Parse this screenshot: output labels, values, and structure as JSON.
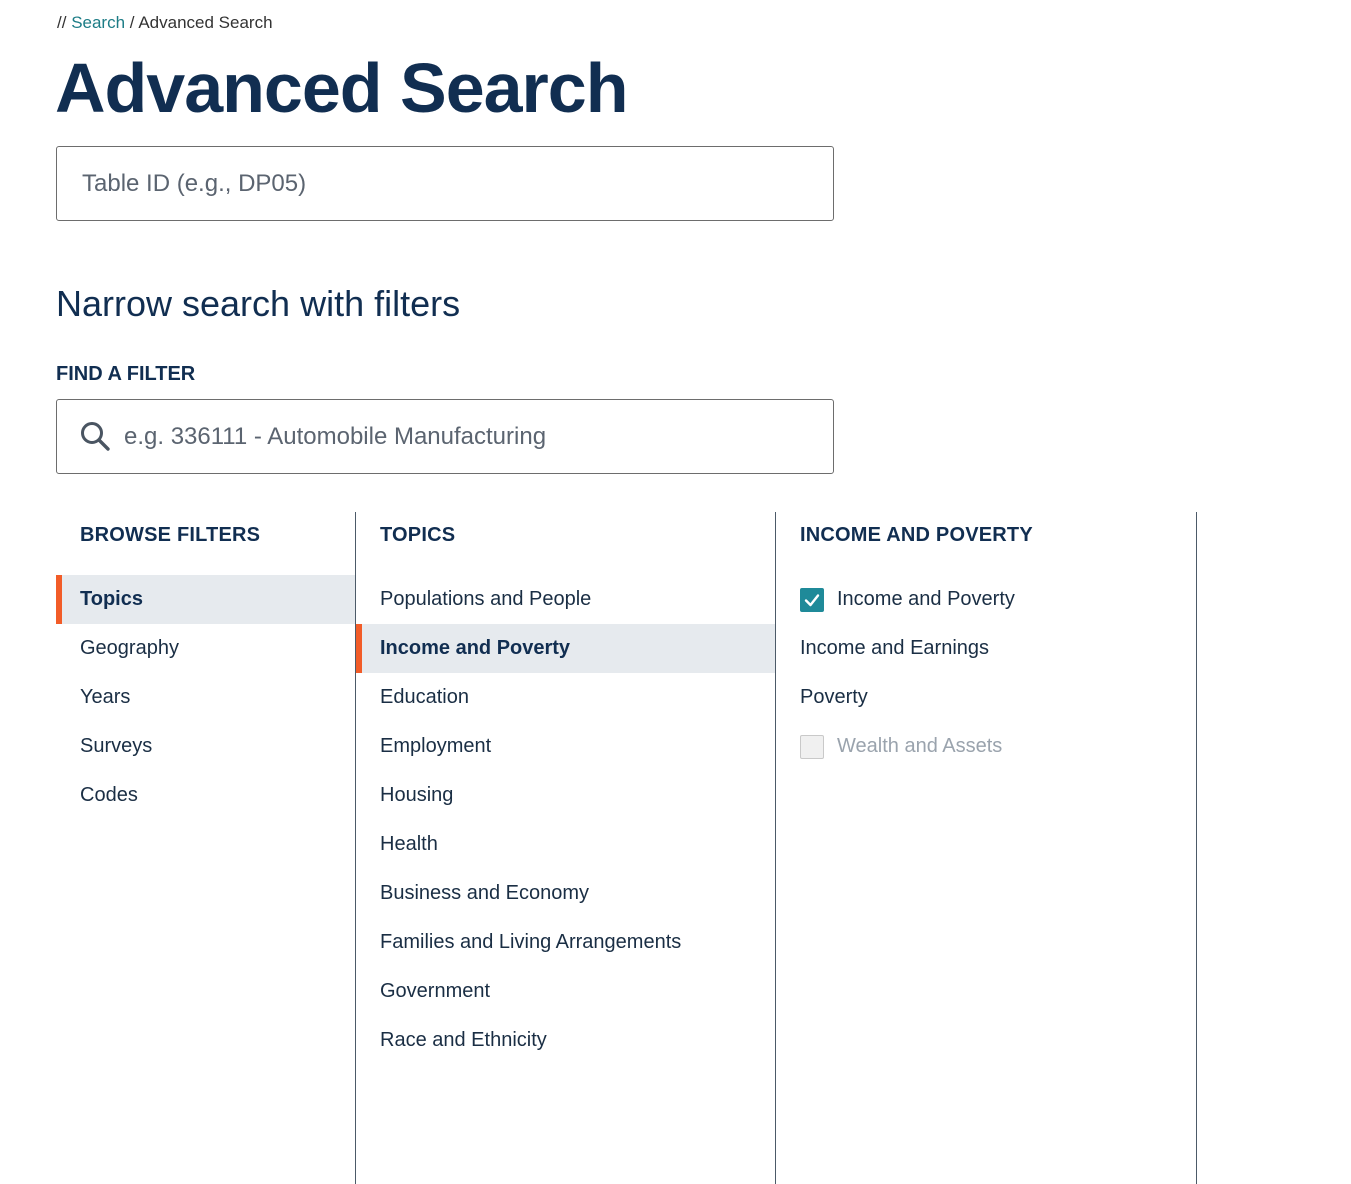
{
  "breadcrumb": {
    "prefix": "//",
    "link": "Search",
    "separator": "/",
    "current": "Advanced Search"
  },
  "title": "Advanced Search",
  "table_id": {
    "placeholder": "Table ID (e.g., DP05)",
    "value": ""
  },
  "narrow_title": "Narrow search with filters",
  "find_filter": {
    "label": "FIND A FILTER",
    "placeholder": "e.g. 336111 - Automobile Manufacturing",
    "icon": "search-icon"
  },
  "browse": {
    "heading": "BROWSE FILTERS",
    "items": [
      "Topics",
      "Geography",
      "Years",
      "Surveys",
      "Codes"
    ],
    "selected": "Topics"
  },
  "topics": {
    "heading": "TOPICS",
    "items": [
      "Populations and People",
      "Income and Poverty",
      "Education",
      "Employment",
      "Housing",
      "Health",
      "Business and Economy",
      "Families and Living Arrangements",
      "Government",
      "Race and Ethnicity"
    ],
    "selected": "Income and Poverty"
  },
  "income_poverty": {
    "heading": "INCOME AND POVERTY",
    "items": [
      {
        "label": "Income and Poverty",
        "checkbox": "checked"
      },
      {
        "label": "Income and Earnings",
        "checkbox": "none"
      },
      {
        "label": "Poverty",
        "checkbox": "none"
      },
      {
        "label": "Wealth and Assets",
        "checkbox": "unchecked-disabled"
      }
    ]
  },
  "colors": {
    "accent": "#f25c28",
    "teal": "#1f8a99",
    "navy": "#112e51",
    "link": "#1c7c86"
  }
}
